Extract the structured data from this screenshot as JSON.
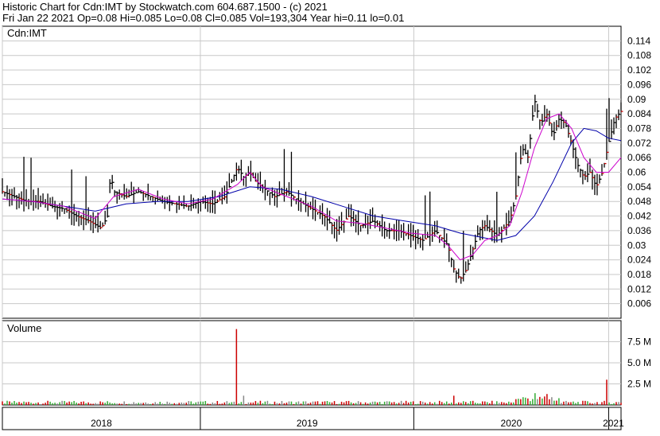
{
  "header": {
    "line1": "Historic Chart for Cdn:IMT by Stockwatch.com 604.687.1500 - (c) 2021",
    "line2": "Fri Jan 22 2021   Op=0.08  Hi=0.085  Lo=0.08  Cl=0.085  Vol=193,304  Year hi=0.11  lo=0.01"
  },
  "colors": {
    "price_bar": "#000000",
    "down_tick": "#cc0000",
    "ma_short": "#cc00cc",
    "ma_long": "#0000aa",
    "vol_up": "#33aa33",
    "vol_down": "#cc0000",
    "vol_neutral": "#888888",
    "grid": "#c8c8c8"
  },
  "chart_data": [
    {
      "type": "line",
      "panel_label": "Cdn:IMT",
      "ylim": [
        0,
        0.12
      ],
      "yticks": [
        "0.114",
        "0.108",
        "0.102",
        "0.096",
        "0.09",
        "0.084",
        "0.078",
        "0.072",
        "0.066",
        "0.06",
        "0.054",
        "0.048",
        "0.042",
        "0.036",
        "0.03",
        "0.024",
        "0.018",
        "0.012",
        "0.006"
      ],
      "x_labels": [
        "2018",
        "2019",
        "2020",
        "2021"
      ],
      "year_fraction_ticks": [
        0,
        0.32,
        0.665,
        0.98
      ],
      "price_path": [
        [
          0.0,
          0.052
        ],
        [
          0.02,
          0.05
        ],
        [
          0.04,
          0.048
        ],
        [
          0.06,
          0.048
        ],
        [
          0.08,
          0.046
        ],
        [
          0.1,
          0.045
        ],
        [
          0.12,
          0.042
        ],
        [
          0.14,
          0.04
        ],
        [
          0.16,
          0.037
        ],
        [
          0.17,
          0.042
        ],
        [
          0.175,
          0.06
        ],
        [
          0.18,
          0.052
        ],
        [
          0.2,
          0.05
        ],
        [
          0.22,
          0.052
        ],
        [
          0.24,
          0.05
        ],
        [
          0.26,
          0.048
        ],
        [
          0.28,
          0.047
        ],
        [
          0.3,
          0.046
        ],
        [
          0.32,
          0.048
        ],
        [
          0.34,
          0.047
        ],
        [
          0.36,
          0.05
        ],
        [
          0.38,
          0.062
        ],
        [
          0.39,
          0.058
        ],
        [
          0.4,
          0.06
        ],
        [
          0.41,
          0.056
        ],
        [
          0.42,
          0.054
        ],
        [
          0.44,
          0.05
        ],
        [
          0.46,
          0.052
        ],
        [
          0.48,
          0.048
        ],
        [
          0.5,
          0.045
        ],
        [
          0.52,
          0.042
        ],
        [
          0.54,
          0.036
        ],
        [
          0.56,
          0.042
        ],
        [
          0.58,
          0.038
        ],
        [
          0.6,
          0.04
        ],
        [
          0.62,
          0.036
        ],
        [
          0.64,
          0.036
        ],
        [
          0.66,
          0.034
        ],
        [
          0.68,
          0.032
        ],
        [
          0.7,
          0.036
        ],
        [
          0.72,
          0.03
        ],
        [
          0.73,
          0.02
        ],
        [
          0.74,
          0.016
        ],
        [
          0.75,
          0.02
        ],
        [
          0.76,
          0.028
        ],
        [
          0.77,
          0.036
        ],
        [
          0.78,
          0.038
        ],
        [
          0.8,
          0.034
        ],
        [
          0.82,
          0.04
        ],
        [
          0.83,
          0.05
        ],
        [
          0.84,
          0.07
        ],
        [
          0.85,
          0.066
        ],
        [
          0.86,
          0.09
        ],
        [
          0.87,
          0.08
        ],
        [
          0.88,
          0.084
        ],
        [
          0.89,
          0.075
        ],
        [
          0.9,
          0.082
        ],
        [
          0.91,
          0.08
        ],
        [
          0.92,
          0.072
        ],
        [
          0.93,
          0.063
        ],
        [
          0.94,
          0.058
        ],
        [
          0.95,
          0.06
        ],
        [
          0.96,
          0.054
        ],
        [
          0.97,
          0.06
        ],
        [
          0.98,
          0.072
        ],
        [
          0.99,
          0.082
        ],
        [
          1.0,
          0.085
        ]
      ],
      "ma_short": [
        [
          0.0,
          0.049
        ],
        [
          0.05,
          0.048
        ],
        [
          0.1,
          0.046
        ],
        [
          0.15,
          0.041
        ],
        [
          0.18,
          0.05
        ],
        [
          0.22,
          0.053
        ],
        [
          0.26,
          0.049
        ],
        [
          0.3,
          0.047
        ],
        [
          0.34,
          0.049
        ],
        [
          0.38,
          0.055
        ],
        [
          0.4,
          0.06
        ],
        [
          0.42,
          0.054
        ],
        [
          0.46,
          0.05
        ],
        [
          0.5,
          0.046
        ],
        [
          0.54,
          0.04
        ],
        [
          0.58,
          0.039
        ],
        [
          0.62,
          0.037
        ],
        [
          0.66,
          0.035
        ],
        [
          0.7,
          0.034
        ],
        [
          0.72,
          0.03
        ],
        [
          0.74,
          0.024
        ],
        [
          0.76,
          0.026
        ],
        [
          0.78,
          0.032
        ],
        [
          0.8,
          0.034
        ],
        [
          0.82,
          0.038
        ],
        [
          0.84,
          0.052
        ],
        [
          0.86,
          0.07
        ],
        [
          0.88,
          0.082
        ],
        [
          0.9,
          0.084
        ],
        [
          0.92,
          0.078
        ],
        [
          0.94,
          0.066
        ],
        [
          0.96,
          0.06
        ],
        [
          0.98,
          0.06
        ],
        [
          1.0,
          0.066
        ]
      ],
      "ma_long": [
        [
          0.0,
          0.049
        ],
        [
          0.05,
          0.048
        ],
        [
          0.1,
          0.046
        ],
        [
          0.15,
          0.044
        ],
        [
          0.2,
          0.047
        ],
        [
          0.25,
          0.048
        ],
        [
          0.3,
          0.048
        ],
        [
          0.35,
          0.05
        ],
        [
          0.4,
          0.054
        ],
        [
          0.45,
          0.053
        ],
        [
          0.5,
          0.05
        ],
        [
          0.55,
          0.046
        ],
        [
          0.6,
          0.042
        ],
        [
          0.65,
          0.04
        ],
        [
          0.7,
          0.038
        ],
        [
          0.74,
          0.035
        ],
        [
          0.78,
          0.033
        ],
        [
          0.8,
          0.032
        ],
        [
          0.83,
          0.034
        ],
        [
          0.86,
          0.042
        ],
        [
          0.89,
          0.056
        ],
        [
          0.92,
          0.072
        ],
        [
          0.94,
          0.078
        ],
        [
          0.96,
          0.077
        ],
        [
          0.98,
          0.074
        ],
        [
          1.0,
          0.073
        ]
      ]
    },
    {
      "type": "bar",
      "panel_label": "Volume",
      "ylim": [
        0,
        10
      ],
      "yticks": [
        "7.5 M",
        "5.0 M",
        "2.5 M"
      ],
      "ytick_values": [
        7.5,
        5.0,
        2.5
      ],
      "units": "M",
      "spikes": [
        [
          0.38,
          9.0
        ],
        [
          0.975,
          3.0
        ],
        [
          0.73,
          1.1
        ],
        [
          0.86,
          1.4
        ],
        [
          0.88,
          1.3
        ],
        [
          0.39,
          1.1
        ]
      ]
    }
  ]
}
